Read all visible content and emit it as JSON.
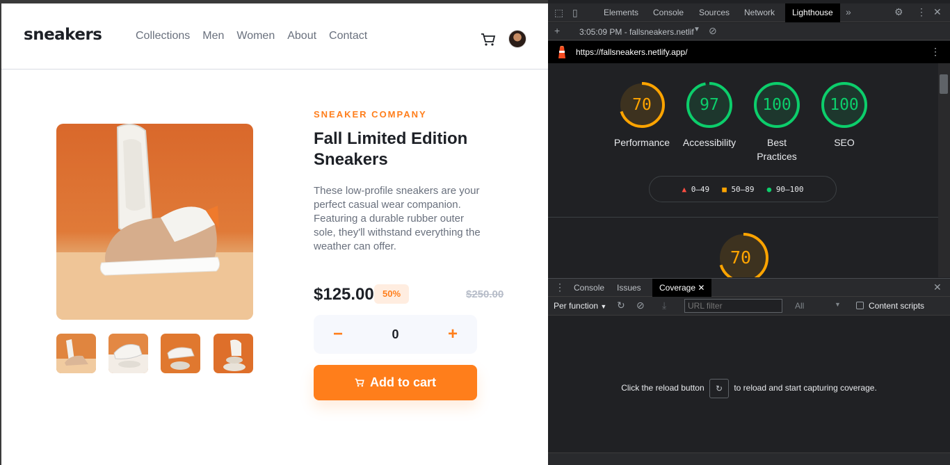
{
  "store": {
    "logo": "sneakers",
    "nav": [
      "Collections",
      "Men",
      "Women",
      "About",
      "Contact"
    ],
    "company": "SNEAKER COMPANY",
    "title": "Fall Limited Edition Sneakers",
    "description": "These low-profile sneakers are your perfect casual wear companion. Featuring a durable rubber outer sole, they'll withstand everything the weather can offer.",
    "price": "$125.00",
    "discount": "50%",
    "old_price": "$250.00",
    "quantity": "0",
    "minus": "−",
    "plus": "+",
    "add_to_cart": "Add to cart",
    "accent": "#ff7e1b"
  },
  "devtools": {
    "tabs": [
      "Elements",
      "Console",
      "Sources",
      "Network",
      "Lighthouse"
    ],
    "active_tab": "Lighthouse",
    "report_select": "3:05:09 PM - fallsneakers.netlif",
    "url": "https://fallsneakers.netlify.app/",
    "scores": [
      {
        "label": "Performance",
        "value": 70,
        "color": "#ffa400"
      },
      {
        "label": "Accessibility",
        "value": 97,
        "color": "#0cce6b"
      },
      {
        "label": "Best Practices",
        "value": 100,
        "color": "#0cce6b"
      },
      {
        "label": "SEO",
        "value": 100,
        "color": "#0cce6b"
      }
    ],
    "legend": [
      {
        "range": "0–49",
        "shape": "triangle",
        "color": "#ff4e42"
      },
      {
        "range": "50–89",
        "shape": "square",
        "color": "#ffa400"
      },
      {
        "range": "90–100",
        "shape": "circle",
        "color": "#0cce6b"
      }
    ],
    "performance_gauge": 70,
    "drawer_tabs": [
      "Console",
      "Issues",
      "Coverage"
    ],
    "drawer_active": "Coverage",
    "coverage": {
      "mode": "Per function",
      "url_filter_placeholder": "URL filter",
      "type_filter": "All",
      "content_scripts": "Content scripts",
      "message_before": "Click the reload button",
      "message_after": "to reload and start capturing coverage."
    }
  }
}
